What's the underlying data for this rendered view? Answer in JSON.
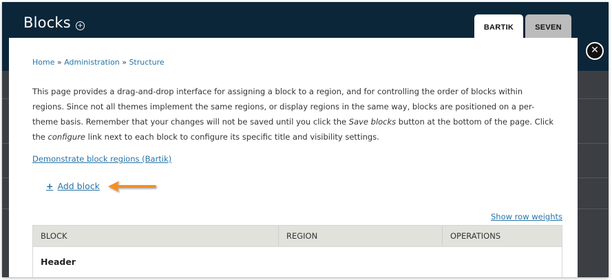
{
  "window": {
    "title": "Blocks",
    "title_icon": "plus-circle-icon",
    "theme_tabs": [
      {
        "label": "BARTIK",
        "active": true
      },
      {
        "label": "SEVEN",
        "active": false
      }
    ],
    "close_icon": "close-icon"
  },
  "breadcrumb": {
    "items": [
      "Home",
      "Administration",
      "Structure"
    ],
    "separator": "»"
  },
  "description": {
    "part1": "This page provides a drag-and-drop interface for assigning a block to a region, and for controlling the order of blocks within regions. Since not all themes implement the same regions, or display regions in the same way, blocks are positioned on a per-theme basis. Remember that your changes will not be saved until you click the ",
    "em1": "Save blocks",
    "part2": " button at the bottom of the page. Click the ",
    "em2": "configure",
    "part3": " link next to each block to configure its specific title and visibility settings."
  },
  "links": {
    "demonstrate": "Demonstrate block regions (Bartik)",
    "add_block": "Add block",
    "add_block_icon": "plus-icon",
    "show_row_weights": "Show row weights"
  },
  "table": {
    "headers": [
      "BLOCK",
      "REGION",
      "OPERATIONS"
    ],
    "region_rows": [
      "Header"
    ]
  },
  "colors": {
    "header_bg": "#0b2639",
    "link": "#2774a6",
    "arrow": "#f39020"
  }
}
